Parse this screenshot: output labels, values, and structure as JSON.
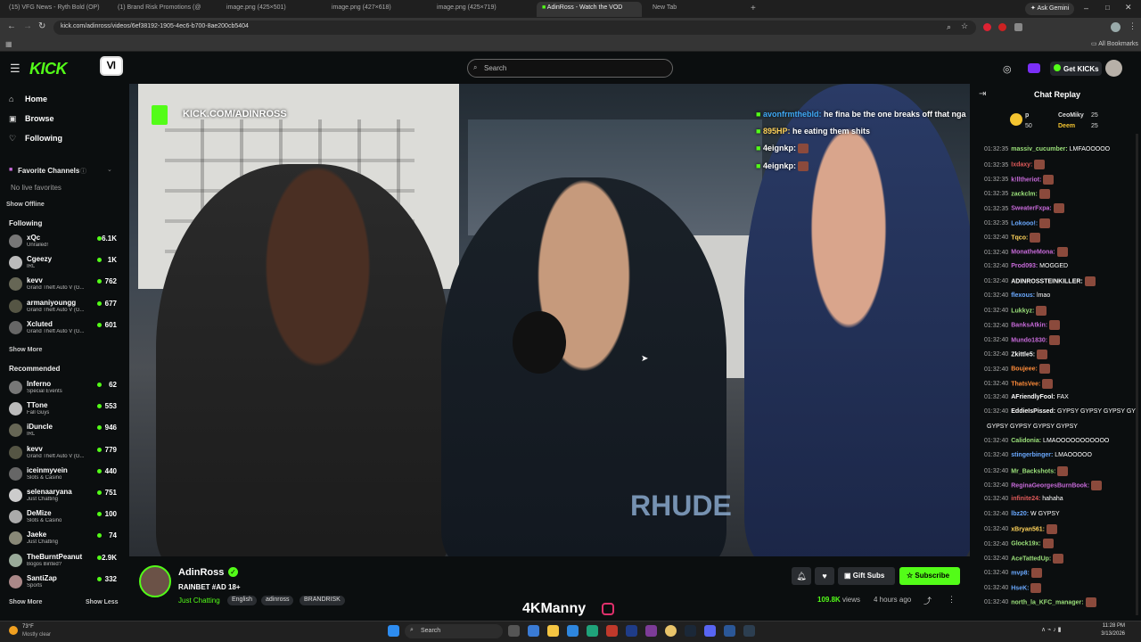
{
  "browser": {
    "tabs": [
      {
        "label": "(15) VFG News - Ryth Bold (OP)"
      },
      {
        "label": "(1) Brand Risk Promotions (@"
      },
      {
        "label": "image.png (425×501)"
      },
      {
        "label": "image.png (427×618)"
      },
      {
        "label": "image.png (425×719)"
      },
      {
        "label": "AdinRoss - Watch the VOD"
      },
      {
        "label": "New Tab"
      }
    ],
    "url": "kick.com/adinross/videos/6ef38192-1905-4ec6-b700-8ae200cb5404",
    "ask_gemini": "Ask Gemini",
    "all_bookmarks": "All Bookmarks"
  },
  "header": {
    "logo": "KICK",
    "search_placeholder": "Search",
    "get_kicks": "Get KICKs"
  },
  "sidebar": {
    "nav": [
      "Home",
      "Browse",
      "Following"
    ],
    "favorite_title": "Favorite Channels",
    "no_live": "No live favorites",
    "show_offline": "Show Offline",
    "following_title": "Following",
    "following": [
      {
        "name": "xQc",
        "cat": "Unrailed!",
        "viewers": "6.1K"
      },
      {
        "name": "Cgeezy",
        "cat": "IRL",
        "viewers": "1K"
      },
      {
        "name": "kevv",
        "cat": "Grand Theft Auto V (G...",
        "viewers": "762"
      },
      {
        "name": "armaniyoungg",
        "cat": "Grand Theft Auto V (G...",
        "viewers": "677"
      },
      {
        "name": "Xcluted",
        "cat": "Grand Theft Auto V (G...",
        "viewers": "601"
      }
    ],
    "show_more": "Show More",
    "recommended_title": "Recommended",
    "recommended": [
      {
        "name": "Inferno",
        "cat": "Special Events",
        "viewers": "62"
      },
      {
        "name": "TTone",
        "cat": "Fall Guys",
        "viewers": "553"
      },
      {
        "name": "iDuncle",
        "cat": "IRL",
        "viewers": "946"
      },
      {
        "name": "kevv",
        "cat": "Grand Theft Auto V (G...",
        "viewers": "779"
      },
      {
        "name": "iceinmyvein",
        "cat": "Slots & Casino",
        "viewers": "440"
      },
      {
        "name": "selenaaryana",
        "cat": "Just Chatting",
        "viewers": "751"
      },
      {
        "name": "DeMize",
        "cat": "Slots & Casino",
        "viewers": "100"
      },
      {
        "name": "Jaeke",
        "cat": "Just Chatting",
        "viewers": "74"
      },
      {
        "name": "TheBurntPeanut",
        "cat": "Bogos Binted?",
        "viewers": "2.9K"
      },
      {
        "name": "SantiZap",
        "cat": "Sports",
        "viewers": "332"
      }
    ],
    "show_more_2": "Show More",
    "show_less": "Show Less"
  },
  "video": {
    "watermark": "KICK.COM/ADINROSS",
    "overlay_chat": [
      {
        "user": "avonfrmthebld:",
        "text": "he fina be the one breaks off that nga"
      },
      {
        "user": "895HP:",
        "text": "he eating them shits"
      },
      {
        "user": "4eignkp:",
        "text": ""
      },
      {
        "user": "4eignkp:",
        "text": ""
      }
    ],
    "shirt_text": "RHUDE"
  },
  "stream": {
    "channel": "AdinRoss",
    "title": "RAINBET #AD 18+",
    "category": "Just Chatting",
    "tags": [
      "English",
      "adinross",
      "BRANDRISK"
    ],
    "views": "109.8K",
    "views_label": "views",
    "time_ago": "4 hours ago",
    "gift_subs": "Gift Subs",
    "subscribe": "Subscribe",
    "overlay_name": "4KManny"
  },
  "chat": {
    "title": "Chat Replay",
    "gifters": [
      {
        "name": "CeoMiky",
        "count": "25"
      },
      {
        "name": "Deem",
        "count": "25"
      },
      {
        "name": "p",
        "count": "50"
      }
    ],
    "messages": [
      {
        "time": "01:32:35",
        "user": "massiv_cucumber:",
        "text": "LMFAOOOOO",
        "color": "#9be07a"
      },
      {
        "time": "01:32:35",
        "user": "Ixdaxy:",
        "text": "",
        "color": "#e05a5a"
      },
      {
        "time": "01:32:35",
        "user": "k!lltheriot:",
        "text": "",
        "color": "#c76ad9"
      },
      {
        "time": "01:32:35",
        "user": "zackclm:",
        "text": "",
        "color": "#9be07a"
      },
      {
        "time": "01:32:35",
        "user": "SweaterFxpa:",
        "text": "",
        "color": "#c76ad9"
      },
      {
        "time": "01:32:35",
        "user": "Lokooo!:",
        "text": "",
        "color": "#6aa9ff"
      },
      {
        "time": "01:32:40",
        "user": "Tqco:",
        "text": "",
        "color": "#ffd35a"
      },
      {
        "time": "01:32:40",
        "user": "MonatheMona:",
        "text": "",
        "color": "#c76ad9"
      },
      {
        "time": "01:32:40",
        "user": "Prod093:",
        "text": "MOGGED",
        "color": "#c76ad9"
      },
      {
        "time": "01:32:40",
        "user": "ADINROSSTEINKILLER:",
        "text": "",
        "color": "#ffffff"
      },
      {
        "time": "01:32:40",
        "user": "flexous:",
        "text": "lmao",
        "color": "#6aa9ff"
      },
      {
        "time": "01:32:40",
        "user": "Lukkyz:",
        "text": "",
        "color": "#9be07a"
      },
      {
        "time": "01:32:40",
        "user": "BanksAtkin:",
        "text": "",
        "color": "#c76ad9"
      },
      {
        "time": "01:32:40",
        "user": "Mundo1830:",
        "text": "",
        "color": "#c76ad9"
      },
      {
        "time": "01:32:40",
        "user": "Zkittle5:",
        "text": "",
        "color": "#ffffff"
      },
      {
        "time": "01:32:40",
        "user": "Boujeee:",
        "text": "",
        "color": "#ff8c3a"
      },
      {
        "time": "01:32:40",
        "user": "ThatsVee:",
        "text": "",
        "color": "#ff8c3a"
      },
      {
        "time": "01:32:40",
        "user": "AFriendlyFool:",
        "text": "FAX",
        "color": "#ffffff"
      },
      {
        "time": "01:32:40",
        "user": "EddieIsPissed:",
        "text": "GYPSY  GYPSY  GYPSY  GYPSY",
        "color": "#ffffff"
      },
      {
        "time": "",
        "user": "",
        "text": "GYPSY   GYPSY   GYPSY   GYPSY",
        "color": "#ffffff"
      },
      {
        "time": "01:32:40",
        "user": "Calidonia:",
        "text": "LMAOOOOOOOOOOO",
        "color": "#9be07a"
      },
      {
        "time": "01:32:40",
        "user": "stingerbinger:",
        "text": "LMAOOOOO",
        "color": "#6aa9ff"
      },
      {
        "time": "01:32:40",
        "user": "Mr_Backshots:",
        "text": "",
        "color": "#9be07a"
      },
      {
        "time": "01:32:40",
        "user": "ReginaGeorgesBurnBook:",
        "text": "",
        "color": "#c76ad9"
      },
      {
        "time": "01:32:40",
        "user": "infinite24:",
        "text": "hahaha",
        "color": "#e05a5a"
      },
      {
        "time": "01:32:40",
        "user": "lbz20:",
        "text": "W GYPSY",
        "color": "#6aa9ff"
      },
      {
        "time": "01:32:40",
        "user": "xBryan561:",
        "text": "",
        "color": "#ffd35a"
      },
      {
        "time": "01:32:40",
        "user": "Glock19x:",
        "text": "",
        "color": "#9be07a"
      },
      {
        "time": "01:32:40",
        "user": "AceTattedUp:",
        "text": "",
        "color": "#9be07a"
      },
      {
        "time": "01:32:40",
        "user": "mvp8:",
        "text": "",
        "color": "#6aa9ff"
      },
      {
        "time": "01:32:40",
        "user": "HseK:",
        "text": "",
        "color": "#6aa9ff"
      },
      {
        "time": "01:32:40",
        "user": "north_la_KFC_manager:",
        "text": "",
        "color": "#9be07a"
      }
    ]
  },
  "taskbar": {
    "weather": "73°F",
    "weather_desc": "Mostly clear",
    "search": "Search",
    "time": "11:28 PM",
    "date": "3/13/2026"
  },
  "colors": {
    "accent": "#53fc18",
    "bg": "#0b0e0f"
  }
}
